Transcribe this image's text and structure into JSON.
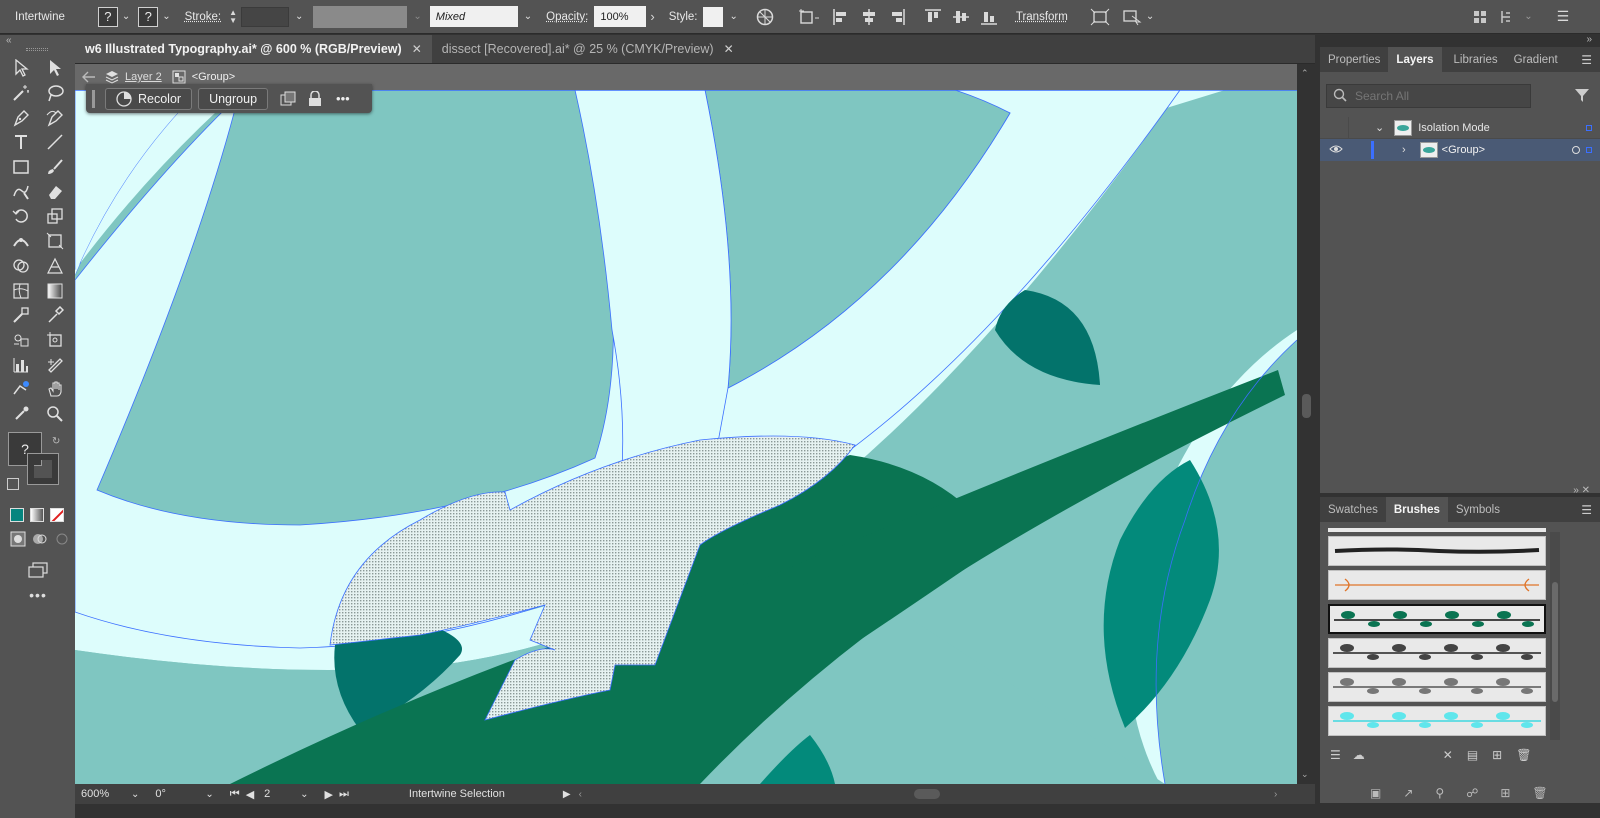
{
  "app": {
    "workspace_name": "Intertwine"
  },
  "control_bar": {
    "stroke_label": "Stroke:",
    "brush_value": "Mixed",
    "opacity_label": "Opacity:",
    "opacity_value": "100%",
    "style_label": "Style:",
    "transform_label": "Transform",
    "unknown_glyph": "?"
  },
  "doc_tabs": [
    {
      "title": "w6 Illustrated Typography.ai* @ 600 % (RGB/Preview)",
      "active": true
    },
    {
      "title": "dissect [Recovered].ai* @ 25 % (CMYK/Preview)",
      "active": false
    }
  ],
  "isolation": {
    "layer": "Layer 2",
    "group": "<Group>"
  },
  "context_bar": {
    "recolor": "Recolor",
    "ungroup": "Ungroup",
    "more": "•••"
  },
  "status": {
    "zoom": "600%",
    "rotation": "0°",
    "artboard": "2",
    "info": "Intertwine Selection"
  },
  "layers_panel": {
    "tabs": [
      "Properties",
      "Layers",
      "Libraries",
      "Gradient"
    ],
    "active_tab": "Layers",
    "search_placeholder": "Search All",
    "rows": [
      {
        "label": "Isolation Mode"
      },
      {
        "label": "<Group>"
      }
    ]
  },
  "brushes_panel": {
    "tabs": [
      "Swatches",
      "Brushes",
      "Symbols"
    ],
    "active_tab": "Brushes"
  },
  "colors": {
    "canvas_light": "#ddfdfc",
    "canvas_mid": "#7fc6c1",
    "leaf_dark": "#03736b",
    "leaf_green": "#0a7452",
    "leaf_teal": "#038a7b",
    "selection": "#3b6fff",
    "fill_swatch": "#06857f"
  }
}
